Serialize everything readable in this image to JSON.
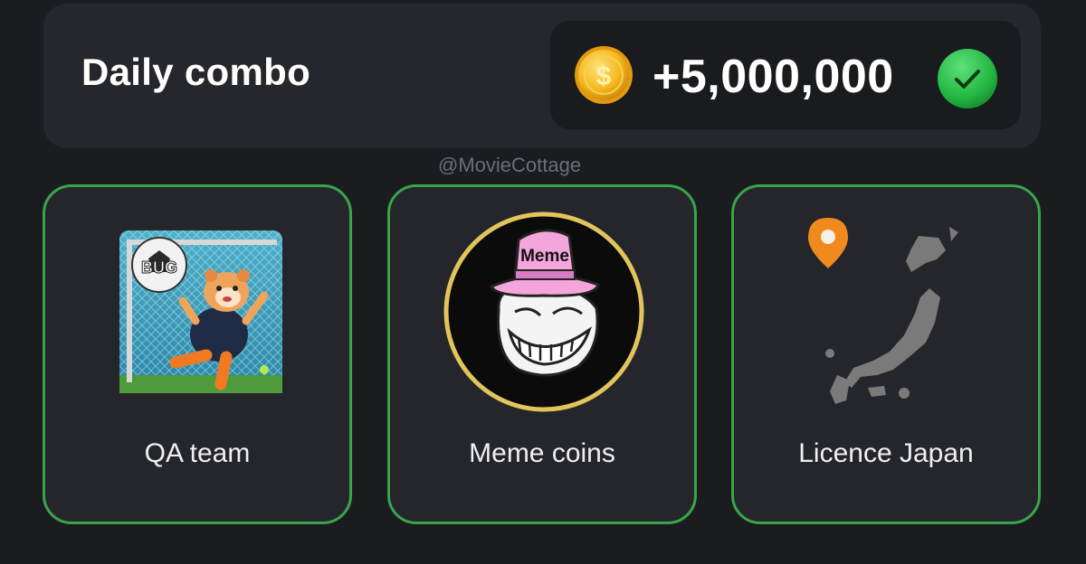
{
  "header": {
    "title": "Daily combo",
    "reward_amount": "+5,000,000",
    "coin_icon": "gold-coin-icon",
    "status_icon": "green-check-icon"
  },
  "watermark": "@MovieCottage",
  "cards": [
    {
      "label": "QA team",
      "icon": "hamster-goalkeeper-image",
      "badge_text": "BUG"
    },
    {
      "label": "Meme coins",
      "icon": "troll-face-hat-image",
      "badge_text": "Meme"
    },
    {
      "label": "Licence Japan",
      "icon": "japan-map-image"
    }
  ],
  "colors": {
    "background": "#1b1c20",
    "card": "#25262b",
    "card_border": "#39a54a",
    "coin": "#f4b81c",
    "check": "#2ebd4a"
  }
}
